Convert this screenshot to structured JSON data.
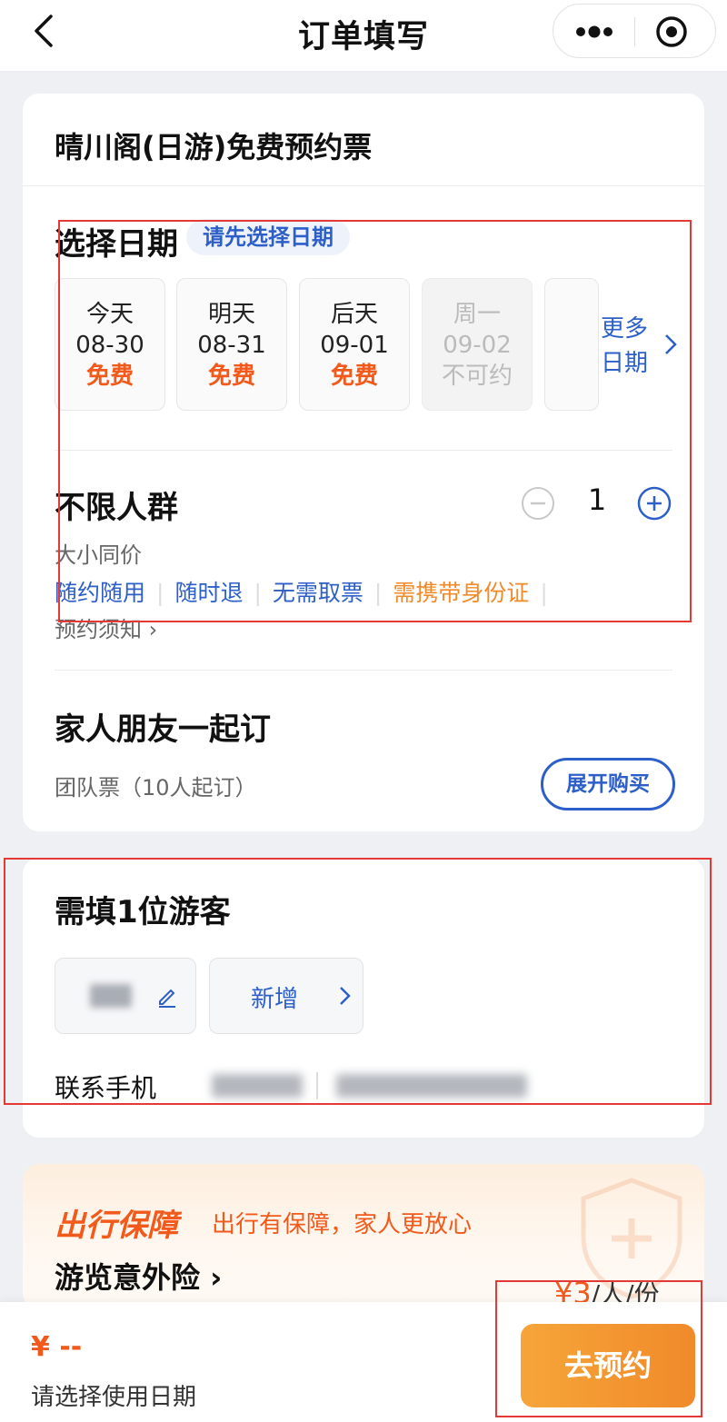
{
  "header": {
    "title": "订单填写"
  },
  "ticket": {
    "name": "晴川阁(日游)免费预约票"
  },
  "date_select": {
    "title": "选择日期",
    "hint": "请先选择日期",
    "dates": [
      {
        "day": "今天",
        "date": "08-30",
        "status": "免费",
        "available": true
      },
      {
        "day": "明天",
        "date": "08-31",
        "status": "免费",
        "available": true
      },
      {
        "day": "后天",
        "date": "09-01",
        "status": "免费",
        "available": true
      },
      {
        "day": "周一",
        "date": "09-02",
        "status": "不可约",
        "available": false
      }
    ],
    "more_line1": "更多",
    "more_line2": "日期"
  },
  "crowd": {
    "title": "不限人群",
    "quantity": "1",
    "price_note": "大小同价",
    "tags": [
      "随约随用",
      "随时退",
      "无需取票",
      "需携带身份证"
    ],
    "notice": "预约须知"
  },
  "group": {
    "title": "家人朋友一起订",
    "subtitle": "团队票（10人起订）",
    "expand_label": "展开购买"
  },
  "visitor": {
    "title": "需填1位游客",
    "add_label": "新增",
    "phone_label": "联系手机"
  },
  "insurance": {
    "brand": "出行保障",
    "slogan": "出行有保障，家人更放心",
    "name": "游览意外险",
    "price": "¥3",
    "unit": "/人/份"
  },
  "bottom": {
    "total": "¥ --",
    "hint": "请选择使用日期",
    "book_label": "去预约"
  },
  "colors": {
    "accent_blue": "#2d5fc9",
    "accent_orange": "#f25a1c",
    "button_orange": "#f08a2a",
    "highlight_red": "#e53935"
  }
}
